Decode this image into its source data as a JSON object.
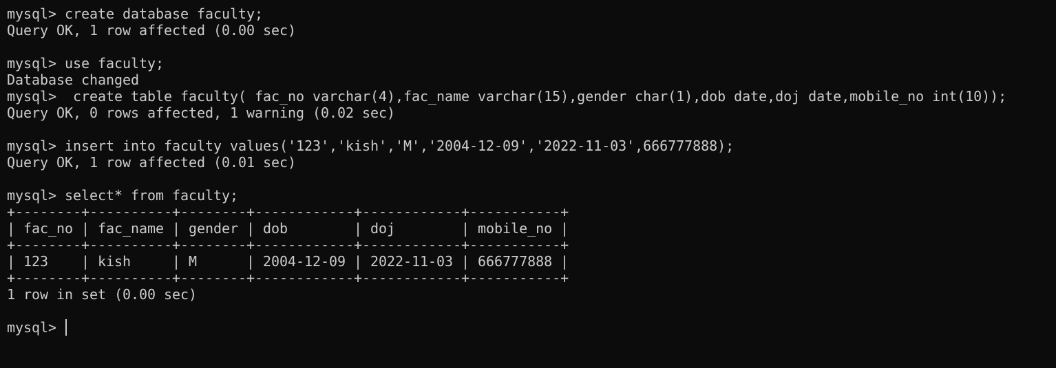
{
  "terminal": {
    "lines": [
      "mysql> create database faculty;",
      "Query OK, 1 row affected (0.00 sec)",
      "",
      "mysql> use faculty;",
      "Database changed",
      "mysql>  create table faculty( fac_no varchar(4),fac_name varchar(15),gender char(1),dob date,doj date,mobile_no int(10));",
      "Query OK, 0 rows affected, 1 warning (0.02 sec)",
      "",
      "mysql> insert into faculty values('123','kish','M','2004-12-09','2022-11-03',666777888);",
      "Query OK, 1 row affected (0.01 sec)",
      "",
      "mysql> select* from faculty;",
      "+--------+----------+--------+------------+------------+-----------+",
      "| fac_no | fac_name | gender | dob        | doj        | mobile_no |",
      "+--------+----------+--------+------------+------------+-----------+",
      "| 123    | kish     | M      | 2004-12-09 | 2022-11-03 | 666777888 |",
      "+--------+----------+--------+------------+------------+-----------+",
      "1 row in set (0.00 sec)",
      ""
    ],
    "current_prompt": "mysql> ",
    "colors": {
      "background": "#0c0c0c",
      "foreground": "#cccccc"
    }
  }
}
